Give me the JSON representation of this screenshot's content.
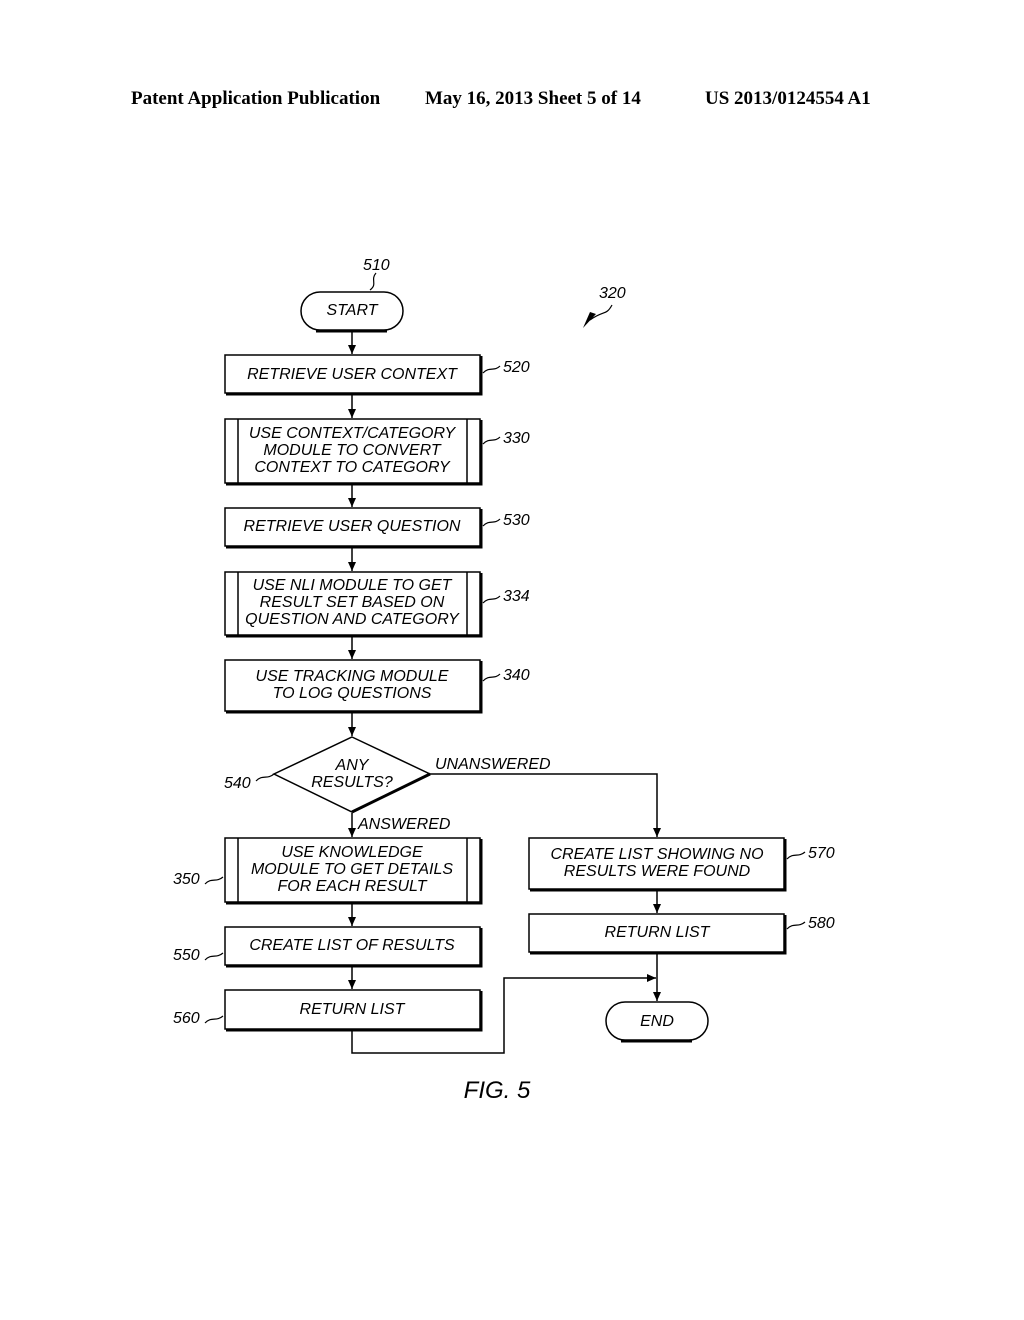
{
  "header": {
    "publication": "Patent Application Publication",
    "date_sheet": "May 16, 2013   Sheet 5 of 14",
    "patent_number": "US 2013/0124554 A1"
  },
  "figure": {
    "caption": "FIG. 5",
    "overall_ref": "320",
    "nodes": {
      "start": {
        "ref": "510",
        "lines": [
          "START"
        ]
      },
      "n520": {
        "ref": "520",
        "lines": [
          "RETRIEVE USER CONTEXT"
        ]
      },
      "n330": {
        "ref": "330",
        "lines": [
          "USE CONTEXT/CATEGORY",
          "MODULE TO CONVERT",
          "CONTEXT TO CATEGORY"
        ]
      },
      "n530": {
        "ref": "530",
        "lines": [
          "RETRIEVE USER QUESTION"
        ]
      },
      "n334": {
        "ref": "334",
        "lines": [
          "USE NLI MODULE TO GET",
          "RESULT SET BASED ON",
          "QUESTION AND CATEGORY"
        ]
      },
      "n340": {
        "ref": "340",
        "lines": [
          "USE TRACKING MODULE",
          "TO LOG QUESTIONS"
        ]
      },
      "n540": {
        "ref": "540",
        "lines": [
          "ANY",
          "RESULTS?"
        ]
      },
      "n350": {
        "ref": "350",
        "lines": [
          "USE KNOWLEDGE",
          "MODULE TO GET DETAILS",
          "FOR EACH RESULT"
        ]
      },
      "n550": {
        "ref": "550",
        "lines": [
          "CREATE LIST OF RESULTS"
        ]
      },
      "n560": {
        "ref": "560",
        "lines": [
          "RETURN LIST"
        ]
      },
      "n570": {
        "ref": "570",
        "lines": [
          "CREATE LIST SHOWING NO",
          "RESULTS WERE FOUND"
        ]
      },
      "n580": {
        "ref": "580",
        "lines": [
          "RETURN LIST"
        ]
      },
      "end": {
        "lines": [
          "END"
        ]
      }
    },
    "edges": {
      "answered": "ANSWERED",
      "unanswered": "UNANSWERED"
    }
  }
}
